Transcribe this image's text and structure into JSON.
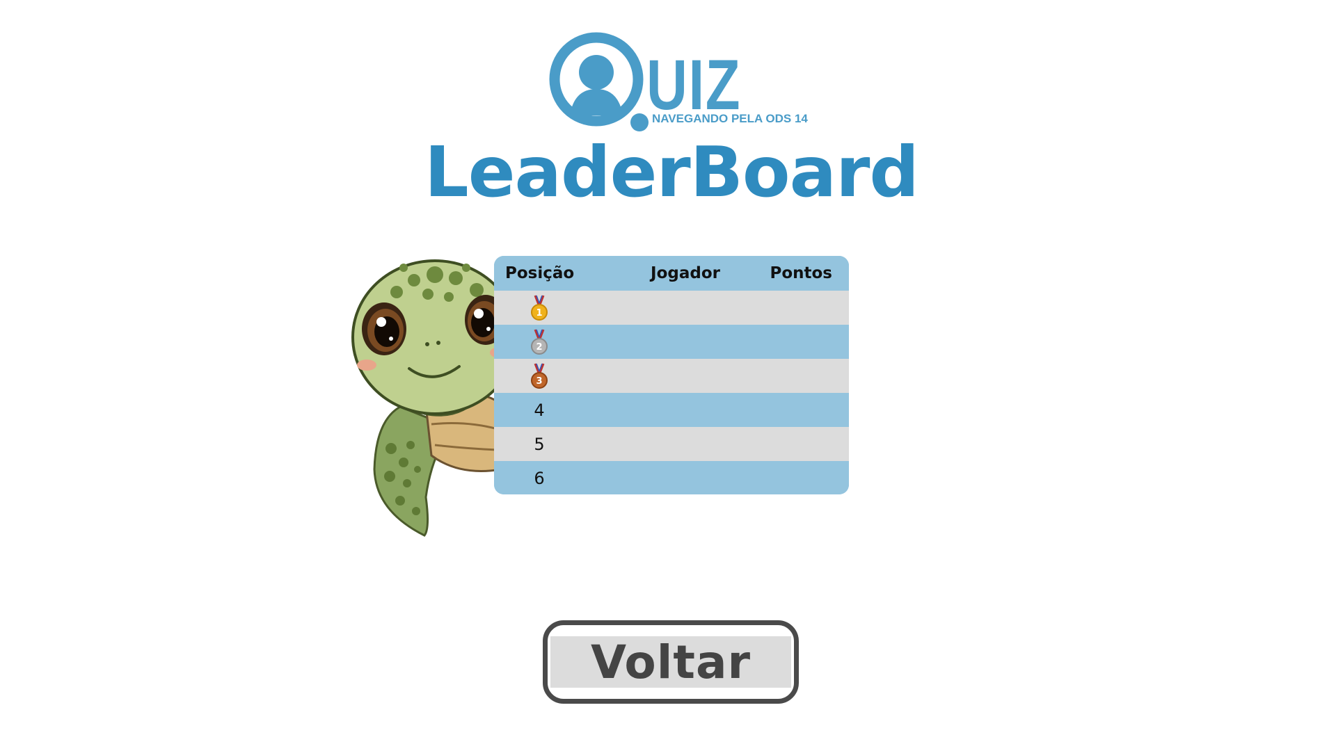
{
  "logo": {
    "word": "UIZ",
    "subtitle": "NAVEGANDO PELA ODS 14",
    "color": "#4a9cc8"
  },
  "title": "LeaderBoard",
  "table": {
    "headers": {
      "position": "Posição",
      "player": "Jogador",
      "points": "Pontos"
    },
    "rows": [
      {
        "position": "1",
        "medal": "gold-medal",
        "player": "",
        "points": ""
      },
      {
        "position": "2",
        "medal": "silver-medal",
        "player": "",
        "points": ""
      },
      {
        "position": "3",
        "medal": "bronze-medal",
        "player": "",
        "points": ""
      },
      {
        "position": "4",
        "medal": null,
        "player": "",
        "points": ""
      },
      {
        "position": "5",
        "medal": null,
        "player": "",
        "points": ""
      },
      {
        "position": "6",
        "medal": null,
        "player": "",
        "points": ""
      }
    ],
    "colors": {
      "header": "#94c4de",
      "row_light": "#dcdcdc",
      "row_blue": "#94c4de"
    }
  },
  "back_button": {
    "label": "Voltar"
  },
  "colors": {
    "title": "#2f8bbf",
    "button_border": "#4a4a4a",
    "button_fill": "#dcdcdc"
  }
}
